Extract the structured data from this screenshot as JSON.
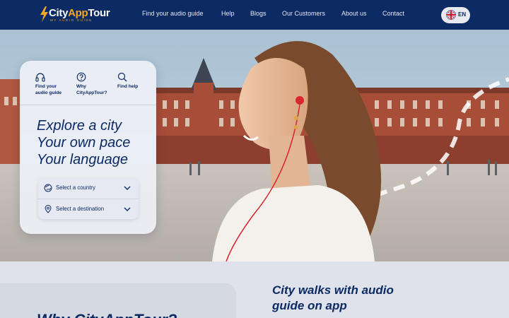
{
  "brand": {
    "name_part1": "City",
    "name_part2": "App",
    "name_part3": "Tour",
    "tagline": "MY AUDIO GUIDE",
    "colors": {
      "navy": "#0c2a63",
      "accent": "#f5a623"
    }
  },
  "nav": {
    "items": [
      {
        "label": "Find your audio guide"
      },
      {
        "label": "Help"
      },
      {
        "label": "Blogs"
      },
      {
        "label": "Our Customers"
      },
      {
        "label": "About us"
      },
      {
        "label": "Contact"
      }
    ],
    "language": {
      "code": "EN",
      "flag_icon": "uk-flag-icon"
    }
  },
  "search_card": {
    "tabs": [
      {
        "label_line1": "Find your",
        "label_line2": "audio guide",
        "icon": "headphones-icon"
      },
      {
        "label_line1": "Why",
        "label_line2": "CityAppTour?",
        "icon": "question-circle-icon"
      },
      {
        "label_line1": "Find help",
        "label_line2": "",
        "icon": "search-icon"
      }
    ],
    "headline": [
      "Explore a city",
      "Your own pace",
      "Your language"
    ],
    "selects": [
      {
        "label": "Select a country",
        "icon": "globe-icon"
      },
      {
        "label": "Select a destination",
        "icon": "location-pin-icon"
      }
    ]
  },
  "sections": {
    "city_walks_title_line1": "City walks with audio",
    "city_walks_title_line2": "guide on app",
    "why_title_partial": "Why CityAppTour?"
  }
}
